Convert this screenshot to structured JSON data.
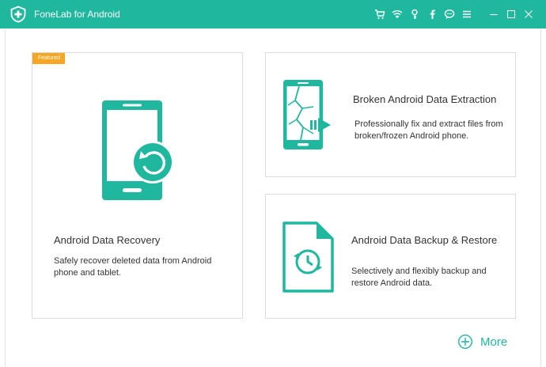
{
  "window": {
    "title": "FoneLab for Android",
    "accent_color": "#1fb79d",
    "toolbar_icons": [
      "cart-icon",
      "wifi-icon",
      "key-icon",
      "facebook-icon",
      "chat-icon",
      "menu-icon"
    ],
    "controls": [
      "minimize-icon",
      "maximize-icon",
      "close-icon"
    ]
  },
  "cards": {
    "recovery": {
      "badge": "Featured",
      "title": "Android Data Recovery",
      "description": "Safely recover deleted data from Android phone and tablet."
    },
    "broken": {
      "title": "Broken Android Data Extraction",
      "description": "Professionally fix and extract files from broken/frozen Android phone."
    },
    "backup": {
      "title": "Android Data Backup & Restore",
      "description": "Selectively and flexibly backup and restore Android data."
    }
  },
  "footer": {
    "more_label": "More"
  }
}
